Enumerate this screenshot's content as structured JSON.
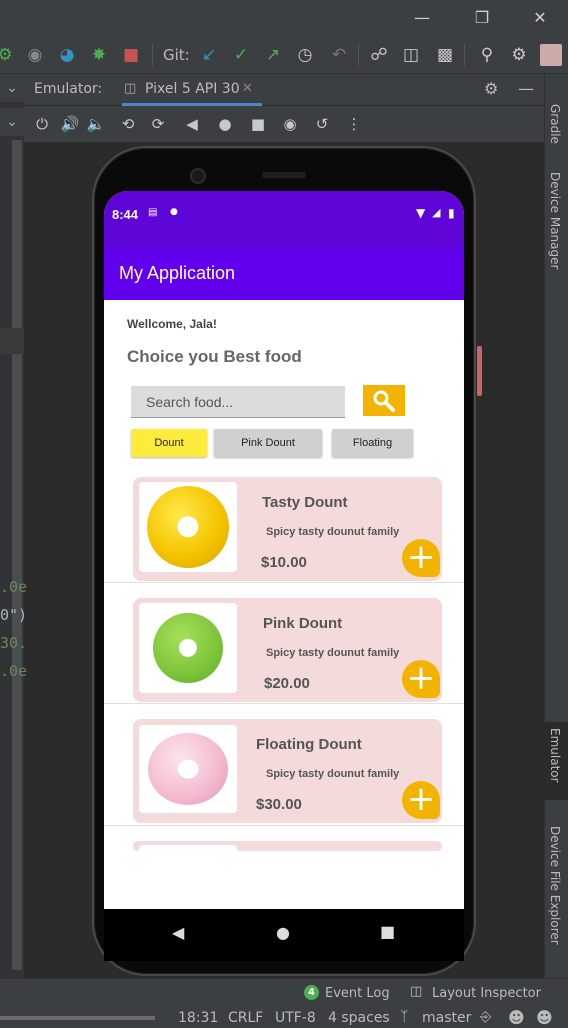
{
  "ide": {
    "git_label": "Git:",
    "emulator_label": "Emulator:",
    "device_tab": "Pixel 5 API 30",
    "code_fragments": [
      ".0e",
      "0\")",
      "30.",
      ".0e"
    ],
    "right_tabs": [
      "Gradle",
      "Device Manager",
      "Emulator",
      "Device File Explorer"
    ],
    "status": {
      "event_log_count": "4",
      "event_log": "Event Log",
      "layout_inspector": "Layout Inspector",
      "position": "18:31",
      "line_ending": "CRLF",
      "encoding": "UTF-8",
      "indent": "4 spaces",
      "branch": "master"
    },
    "colors": {
      "bg": "#2b2b2b",
      "panel": "#3c3f41"
    }
  },
  "phone": {
    "time": "8:44",
    "app_title": "My Application",
    "greeting": "Wellcome, Jala!",
    "headline": "Choice you Best food",
    "search_placeholder": "Search food...",
    "chips": [
      "Dount",
      "Pink Dount",
      "Floating"
    ],
    "items": [
      {
        "title": "Tasty Dount",
        "desc": "Spicy tasty dounut family",
        "price": "$10.00"
      },
      {
        "title": "Pink Dount",
        "desc": "Spicy tasty dounut family",
        "price": "$20.00"
      },
      {
        "title": "Floating Dount",
        "desc": "Spicy tasty dounut family",
        "price": "$30.00"
      }
    ],
    "colors": {
      "status": "#5e05d8",
      "appbar": "#6200ee",
      "accent": "#f2b400",
      "card": "#f4dada",
      "chip_active": "#ffeb3b",
      "chip": "#d0d0d0"
    }
  }
}
